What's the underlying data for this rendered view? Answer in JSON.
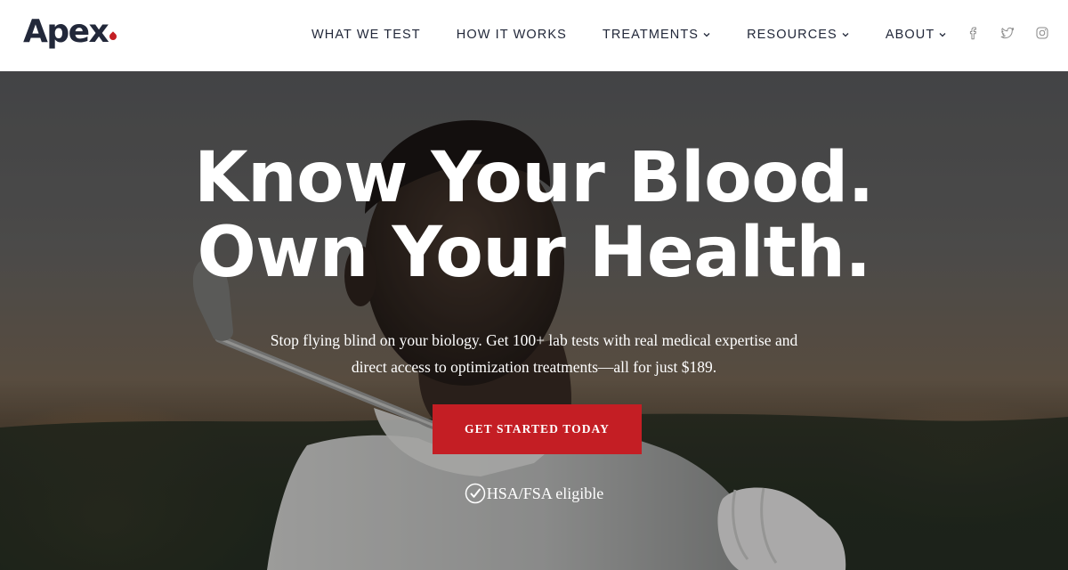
{
  "brand": {
    "name": "Apex",
    "accent_color": "#c41e24",
    "text_color": "#22283a"
  },
  "nav": {
    "items": [
      {
        "label": "WHAT WE TEST",
        "has_dropdown": false
      },
      {
        "label": "HOW IT WORKS",
        "has_dropdown": false
      },
      {
        "label": "TREATMENTS",
        "has_dropdown": true
      },
      {
        "label": "RESOURCES",
        "has_dropdown": true
      },
      {
        "label": "ABOUT",
        "has_dropdown": true
      }
    ],
    "dropdown_icon": "chevron-down-icon"
  },
  "social": {
    "icons": [
      "facebook-icon",
      "twitter-icon",
      "instagram-icon"
    ],
    "icon_color": "#8a8a8a"
  },
  "hero": {
    "title_line1": "Know Your Blood.",
    "title_line2": "Own Your Health.",
    "subtitle_line1": "Stop flying blind on your biology. Get 100+ lab tests with real medical expertise and",
    "subtitle_line2": "direct access to optimization treatments—all for just $189.",
    "cta_label": "GET STARTED TODAY",
    "badge_icon": "check-circle-icon",
    "badge_text": "HSA/FSA eligible"
  }
}
